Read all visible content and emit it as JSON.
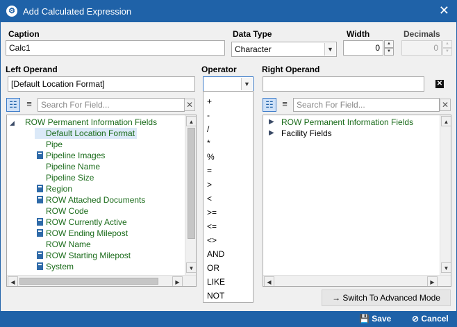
{
  "window": {
    "title": "Add Calculated Expression"
  },
  "caption": {
    "label": "Caption",
    "value": "Calc1"
  },
  "data_type": {
    "label": "Data Type",
    "value": "Character"
  },
  "width": {
    "label": "Width",
    "value": "0"
  },
  "decimals": {
    "label": "Decimals",
    "value": "0"
  },
  "left_operand": {
    "label": "Left Operand",
    "value": "[Default Location Format]"
  },
  "operator": {
    "label": "Operator",
    "value": "",
    "options": [
      "+",
      "-",
      "/",
      "*",
      "%",
      "=",
      ">",
      "<",
      ">=",
      "<=",
      "<>",
      "AND",
      "OR",
      "LIKE",
      "NOT"
    ]
  },
  "right_operand": {
    "label": "Right Operand",
    "value": ""
  },
  "left_panel": {
    "search_placeholder": "Search For Field...",
    "root": "ROW Permanent Information Fields",
    "items": [
      {
        "label": "Default Location Format",
        "icon": "",
        "selected": true
      },
      {
        "label": "Pipe",
        "icon": ""
      },
      {
        "label": "Pipeline Images",
        "icon": "calculator-icon"
      },
      {
        "label": "Pipeline Name",
        "icon": ""
      },
      {
        "label": "Pipeline Size",
        "icon": ""
      },
      {
        "label": "Region",
        "icon": "calculator-icon"
      },
      {
        "label": "ROW Attached Documents",
        "icon": "calculator-icon"
      },
      {
        "label": "ROW Code",
        "icon": ""
      },
      {
        "label": "ROW Currently Active",
        "icon": "calculator-icon"
      },
      {
        "label": "ROW Ending Milepost",
        "icon": "calculator-icon"
      },
      {
        "label": "ROW Name",
        "icon": ""
      },
      {
        "label": "ROW Starting Milepost",
        "icon": "calculator-icon"
      },
      {
        "label": "System",
        "icon": "calculator-icon"
      }
    ]
  },
  "right_panel": {
    "search_placeholder": "Search For Field...",
    "items": [
      "ROW Permanent Information Fields",
      "Facility Fields"
    ]
  },
  "buttons": {
    "advanced": "Switch To Advanced Mode",
    "save": "Save",
    "cancel": "Cancel"
  },
  "colors": {
    "accent": "#1f62a8",
    "field_green": "#1a6b1a",
    "selection": "#dbe9f8"
  }
}
